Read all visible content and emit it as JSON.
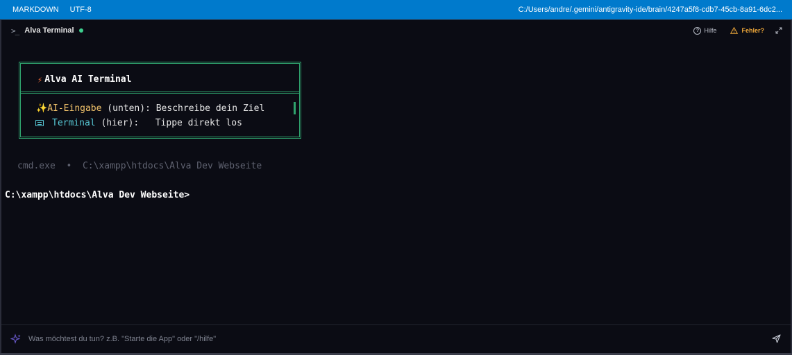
{
  "statusbar": {
    "language": "MARKDOWN",
    "encoding": "UTF-8",
    "path": "C:/Users/andre/.gemini/antigravity-ide/brain/4247a5f8-cdb7-45cb-8a91-6dc2..."
  },
  "header": {
    "title": "Alva Terminal",
    "help_label": "Hilfe",
    "error_label": "Fehler?",
    "status_color": "#3ecf8e"
  },
  "banner": {
    "title": "Alva AI Terminal",
    "ai_label": "AI-Eingabe",
    "ai_desc": " (unten): Beschreibe dein Ziel",
    "terminal_label": "Terminal",
    "terminal_desc": " (hier):   Tippe direkt los",
    "border_color": "#2fa36d"
  },
  "session": {
    "shell": "cmd.exe",
    "separator": "•",
    "cwd": "C:\\xampp\\htdocs\\Alva Dev Webseite"
  },
  "prompt": {
    "text": "C:\\xampp\\htdocs\\Alva Dev Webseite>"
  },
  "input": {
    "placeholder": "Was möchtest du tun? z.B. \"Starte die App\" oder \"/hilfe\"",
    "value": ""
  },
  "colors": {
    "statusbar_bg": "#007acc",
    "background": "#0b0c14",
    "warning": "#f0a93a",
    "accent": "#6a5acd"
  }
}
